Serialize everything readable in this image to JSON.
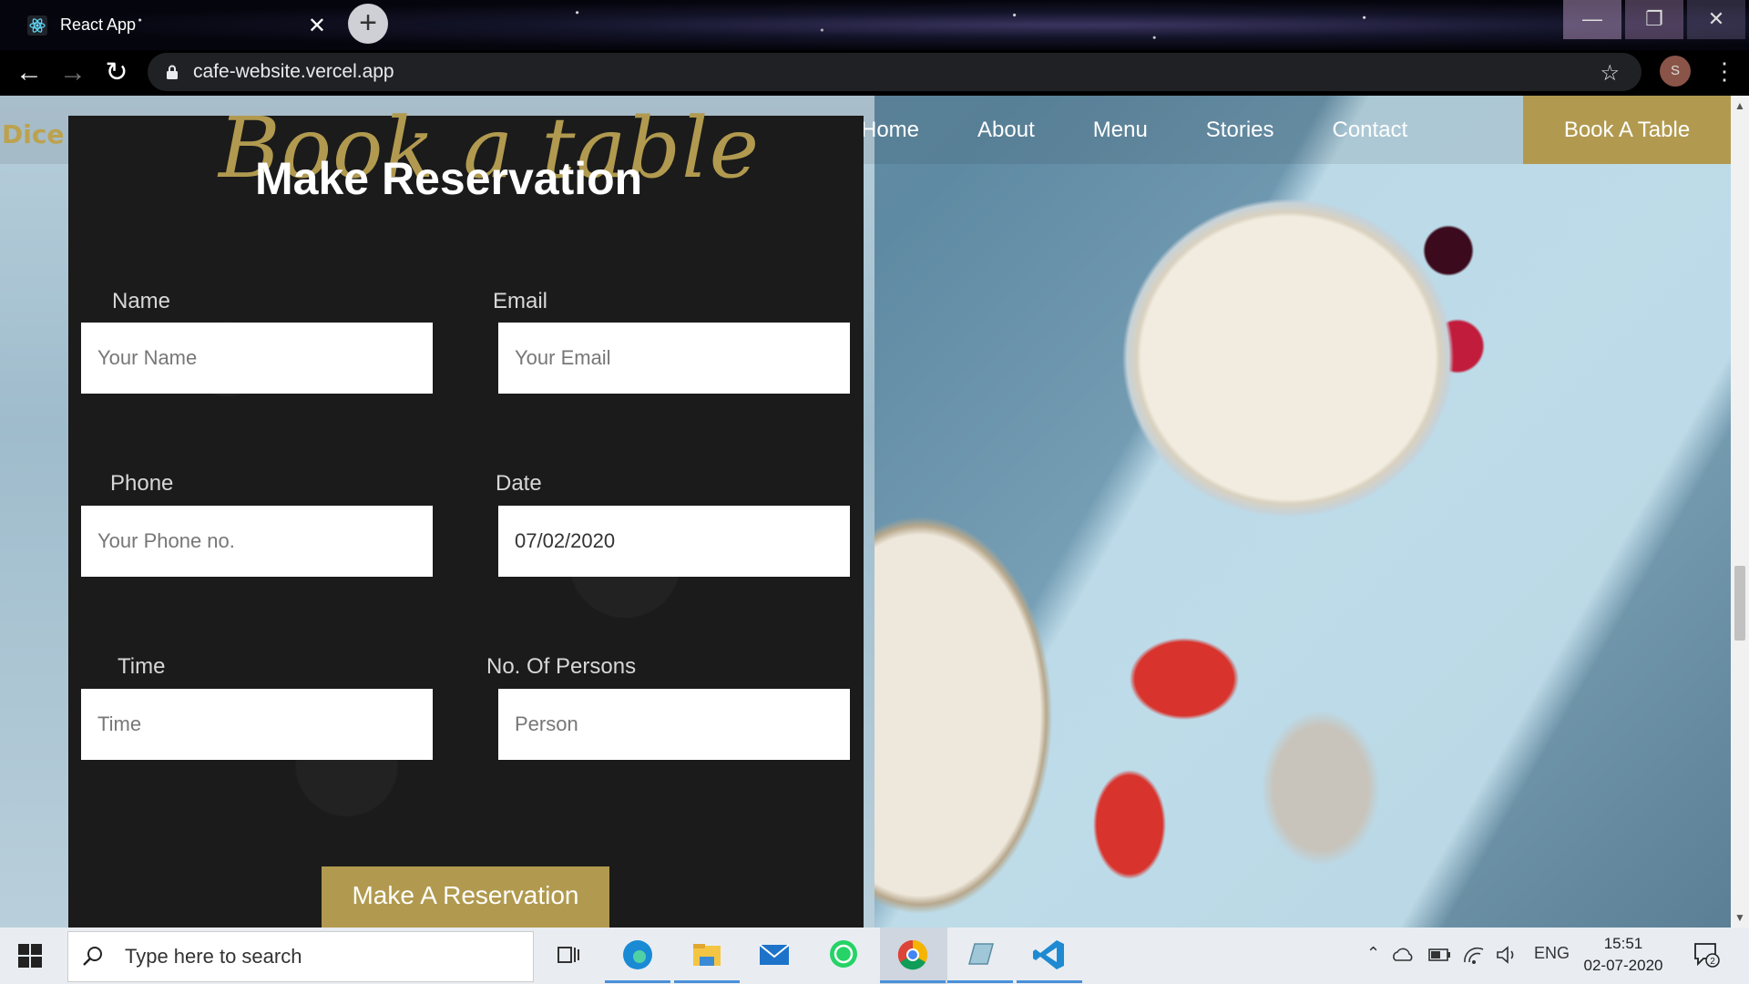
{
  "browser": {
    "tab_title": "React App",
    "tab_close": "✕",
    "new_tab": "+",
    "url": "cafe-website.vercel.app",
    "profile_initial": "S"
  },
  "window_controls": {
    "minimize": "—",
    "maximize": "❐",
    "close": "✕"
  },
  "nav": {
    "brand": "Dice 'n' Dine",
    "links": [
      "Home",
      "About",
      "Menu",
      "Stories",
      "Contact"
    ],
    "cta": "Book A Table"
  },
  "reservation": {
    "script_title": "Book a table",
    "title": "Make Reservation",
    "fields": {
      "name": {
        "label": "Name",
        "placeholder": "Your Name"
      },
      "email": {
        "label": "Email",
        "placeholder": "Your Email"
      },
      "phone": {
        "label": "Phone",
        "placeholder": "Your Phone no."
      },
      "date": {
        "label": "Date",
        "value": "07/02/2020"
      },
      "time": {
        "label": "Time",
        "placeholder": "Time"
      },
      "persons": {
        "label": "No. Of Persons",
        "placeholder": "Person"
      }
    },
    "submit": "Make A Reservation"
  },
  "taskbar": {
    "search_placeholder": "Type here to search",
    "language": "ENG",
    "time": "15:51",
    "date": "02-07-2020",
    "notification_count": "2"
  },
  "colors": {
    "accent": "#b19a4f",
    "panel": "#1b1b1b"
  }
}
